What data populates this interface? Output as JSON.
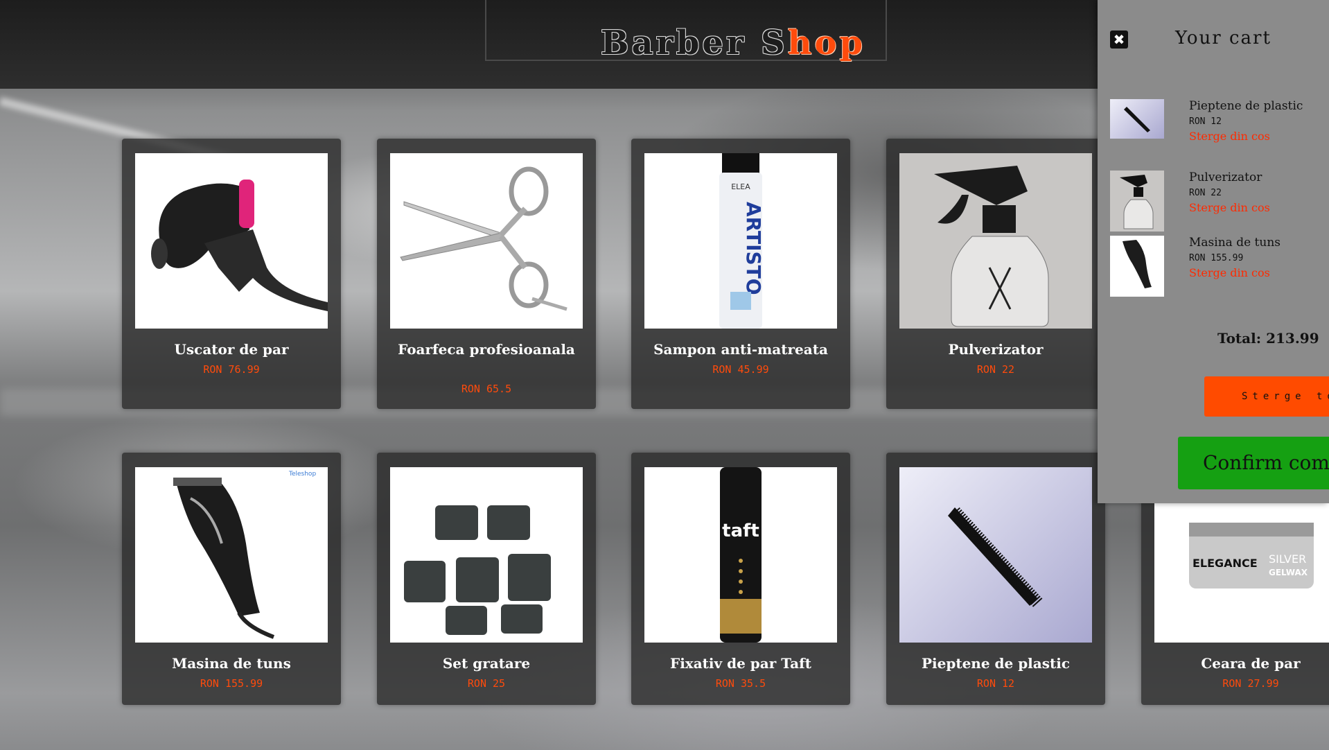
{
  "header": {
    "logo_part1": "Barber S",
    "logo_part2": "hop"
  },
  "products": [
    {
      "name": "Uscator de par",
      "price": "RON 76.99"
    },
    {
      "name": "Foarfeca profesioanala",
      "price": "RON 65.5"
    },
    {
      "name": "Sampon anti-matreata",
      "price": "RON 45.99"
    },
    {
      "name": "Pulverizator",
      "price": "RON 22"
    },
    {
      "name": "Masina de tuns",
      "price": "RON 155.99"
    },
    {
      "name": "Set gratare",
      "price": "RON 25"
    },
    {
      "name": "Fixativ de par Taft",
      "price": "RON 35.5"
    },
    {
      "name": "Pieptene de plastic",
      "price": "RON 12"
    },
    {
      "name": "Ceara de par",
      "price": "RON 27.99"
    }
  ],
  "product_image_texts": {
    "shampoo_brand": "ELEA",
    "shampoo_name": "ARTISTO",
    "spray_brand": "taft",
    "clipper_watermark": "Teleshop",
    "wax_brand": "ELEGANCE",
    "wax_name": "SILVER",
    "wax_type": "GELWAX"
  },
  "cart": {
    "close_icon": "✖",
    "title": "Your cart",
    "items": [
      {
        "name": "Pieptene de plastic",
        "price": "RON 12",
        "remove_label": "Sterge din cos"
      },
      {
        "name": "Pulverizator",
        "price": "RON 22",
        "remove_label": "Sterge din cos"
      },
      {
        "name": "Masina de tuns",
        "price": "RON 155.99",
        "remove_label": "Sterge din cos"
      }
    ],
    "total": "Total: 213.99",
    "clear_label": "Sterge tot",
    "confirm_label": "Confirm comanda"
  },
  "colors": {
    "accent": "#ff4b0c",
    "confirm": "#15a012",
    "remove": "#ff2a00"
  }
}
